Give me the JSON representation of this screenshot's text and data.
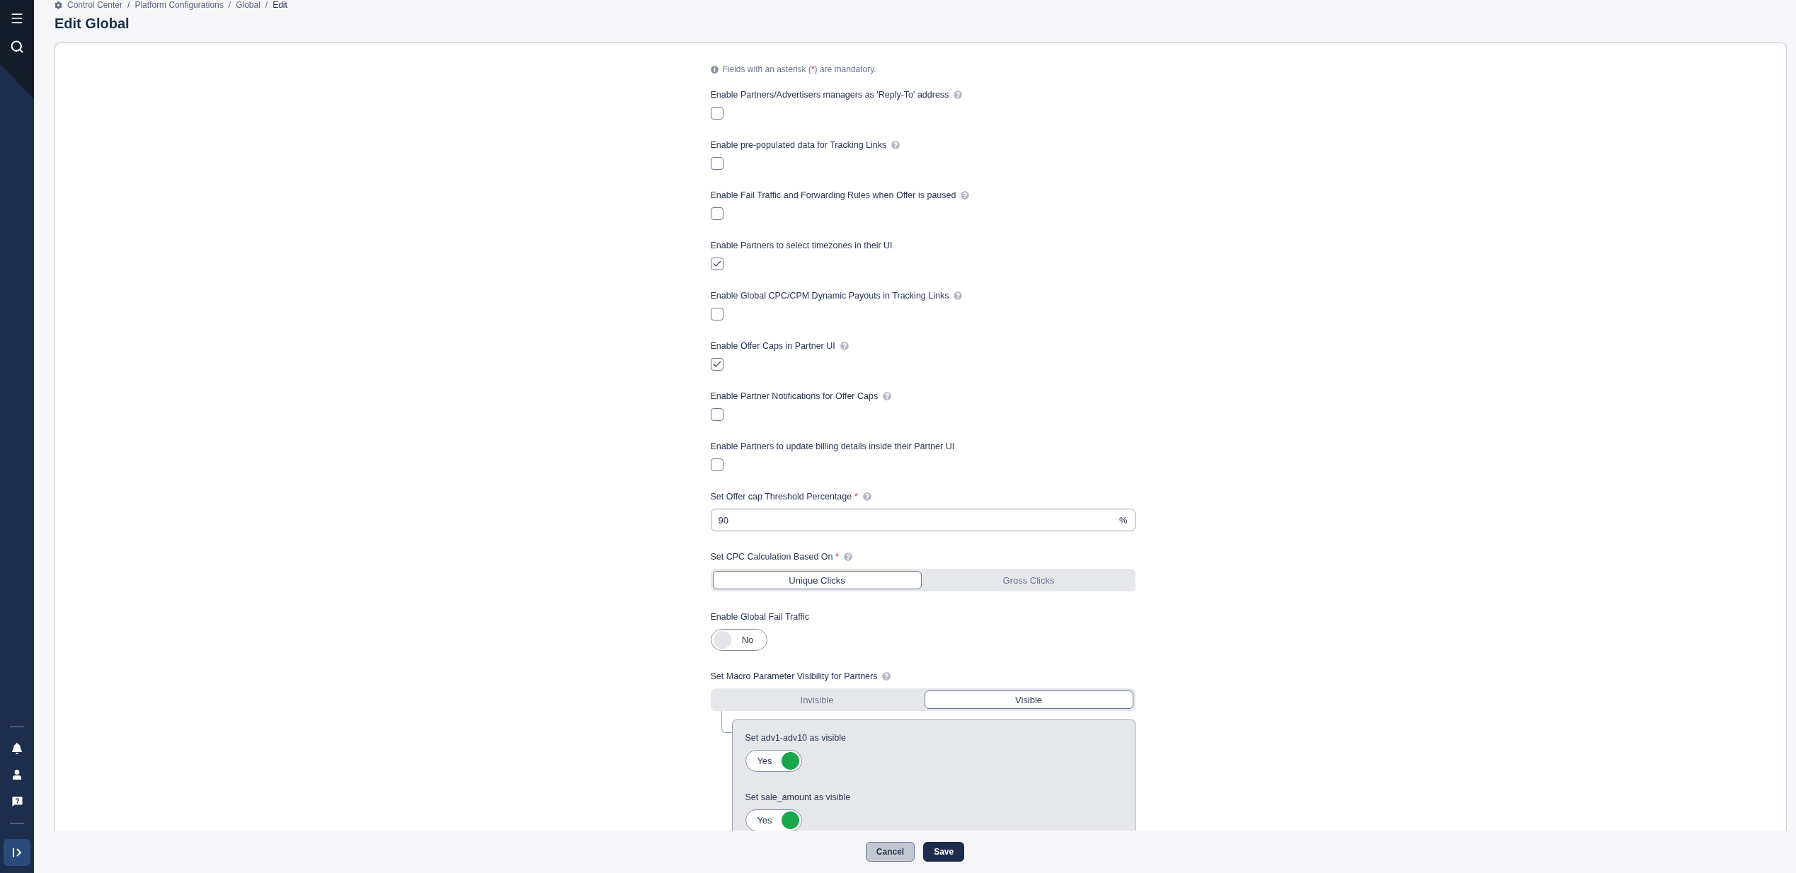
{
  "breadcrumb": [
    {
      "label": "Control Center",
      "current": false
    },
    {
      "separator": "/",
      "label": "Platform Configurations",
      "current": false
    },
    {
      "separator": "/",
      "label": "Global",
      "current": false
    },
    {
      "separator": "/",
      "label": "Edit",
      "current": true
    }
  ],
  "title": "Edit Global",
  "notice": {
    "before": "Fields with an asterisk (",
    "mark": "*",
    "after": ") are mandatory."
  },
  "fields": [
    {
      "kind": "checkbox",
      "label": "Enable Partners/Advertisers managers as 'Reply-To' address",
      "help": true,
      "checked": false
    },
    {
      "kind": "checkbox",
      "label": "Enable pre-populated data for Tracking Links",
      "help": true,
      "checked": false
    },
    {
      "kind": "checkbox",
      "label": "Enable Fail Traffic and Forwarding Rules when Offer is paused",
      "help": true,
      "checked": false
    },
    {
      "kind": "checkbox",
      "label": "Enable Partners to select timezones in their UI",
      "help": false,
      "checked": true
    },
    {
      "kind": "checkbox",
      "label": "Enable Global CPC/CPM Dynamic Payouts in Tracking Links",
      "help": true,
      "checked": false
    },
    {
      "kind": "checkbox",
      "label": "Enable Offer Caps in Partner UI",
      "help": true,
      "checked": true
    },
    {
      "kind": "checkbox",
      "label": "Enable Partner Notifications for Offer Caps",
      "help": true,
      "checked": false
    },
    {
      "kind": "checkbox",
      "label": "Enable Partners to update billing details inside their Partner UI",
      "help": false,
      "checked": false
    },
    {
      "kind": "number",
      "label": "Set Offer cap Threshold Percentage",
      "required": true,
      "help": true,
      "value": "90",
      "suffix": "%"
    },
    {
      "kind": "segmented",
      "label": "Set CPC Calculation Based On",
      "required": true,
      "help": true,
      "options": [
        {
          "label": "Unique Clicks",
          "selected": true
        },
        {
          "label": "Gross Clicks",
          "selected": false
        }
      ]
    },
    {
      "kind": "toggle",
      "label": "Enable Global Fail Traffic",
      "help": false,
      "on": false,
      "state_label": "No"
    },
    {
      "kind": "segmented",
      "label": "Set Macro Parameter Visibility for Partners",
      "required": false,
      "help": true,
      "options": [
        {
          "label": "Invisible",
          "selected": false
        },
        {
          "label": "Visible",
          "selected": true
        }
      ],
      "children": [
        {
          "kind": "toggle",
          "label": "Set adv1-adv10 as visible",
          "help": false,
          "on": true,
          "state_label": "Yes"
        },
        {
          "kind": "toggle",
          "label": "Set sale_amount as visible",
          "help": false,
          "on": true,
          "state_label": "Yes"
        }
      ]
    }
  ],
  "buttons": [
    {
      "label": "Cancel",
      "kind": "secondary"
    },
    {
      "label": "Save",
      "kind": "primary"
    }
  ]
}
